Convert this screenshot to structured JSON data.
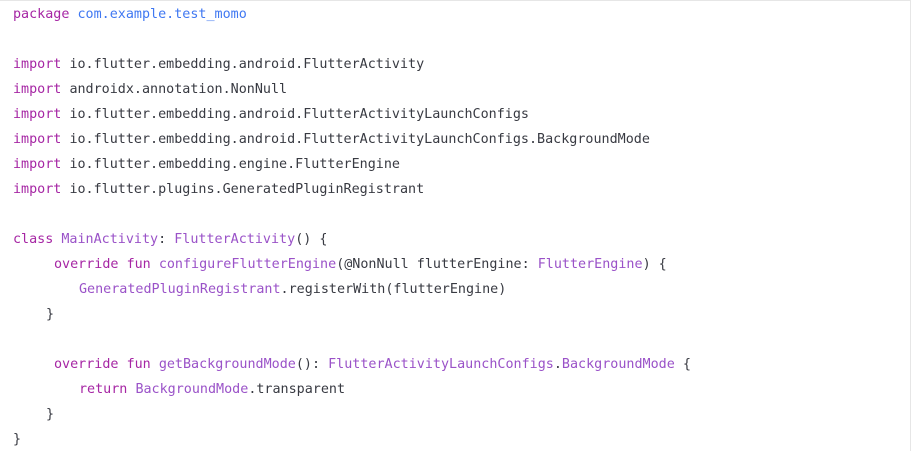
{
  "code": {
    "package_line": {
      "keyword": "package",
      "name": "com.example.test_momo"
    },
    "imports": [
      {
        "keyword": "import",
        "path": "io.flutter.embedding.android.FlutterActivity"
      },
      {
        "keyword": "import",
        "path": "androidx.annotation.NonNull"
      },
      {
        "keyword": "import",
        "path": "io.flutter.embedding.android.FlutterActivityLaunchConfigs"
      },
      {
        "keyword": "import",
        "path": "io.flutter.embedding.android.FlutterActivityLaunchConfigs.BackgroundMode"
      },
      {
        "keyword": "import",
        "path": "io.flutter.embedding.engine.FlutterEngine"
      },
      {
        "keyword": "import",
        "path": "io.flutter.plugins.GeneratedPluginRegistrant"
      }
    ],
    "class_decl": {
      "keyword": "class",
      "name": "MainActivity",
      "sep": ": ",
      "parent": "FlutterActivity",
      "tail": "() {"
    },
    "method1": {
      "override_kw": "override",
      "fun_kw": "fun",
      "name": "configureFlutterEngine",
      "params_open": "(@NonNull flutterEngine",
      "colon": ": ",
      "param_type": "FlutterEngine",
      "params_close": ") {"
    },
    "method1_body": {
      "receiver": "GeneratedPluginRegistrant",
      "call": ".registerWith(flutterEngine)"
    },
    "close_brace_method1": "}",
    "method2": {
      "override_kw": "override",
      "fun_kw": "fun",
      "name": "getBackgroundMode",
      "params": "(): ",
      "ret_type_outer": "FlutterActivityLaunchConfigs",
      "dot": ".",
      "ret_type_inner": "BackgroundMode",
      "open": " {"
    },
    "method2_body": {
      "return_kw": "return",
      "type": "BackgroundMode",
      "member": ".transparent"
    },
    "close_brace_method2": "}",
    "close_brace_class": "}"
  },
  "colors": {
    "keyword": "#a626a4",
    "package_name": "#4078f2",
    "type": "#9a52c8",
    "text": "#383a42"
  }
}
